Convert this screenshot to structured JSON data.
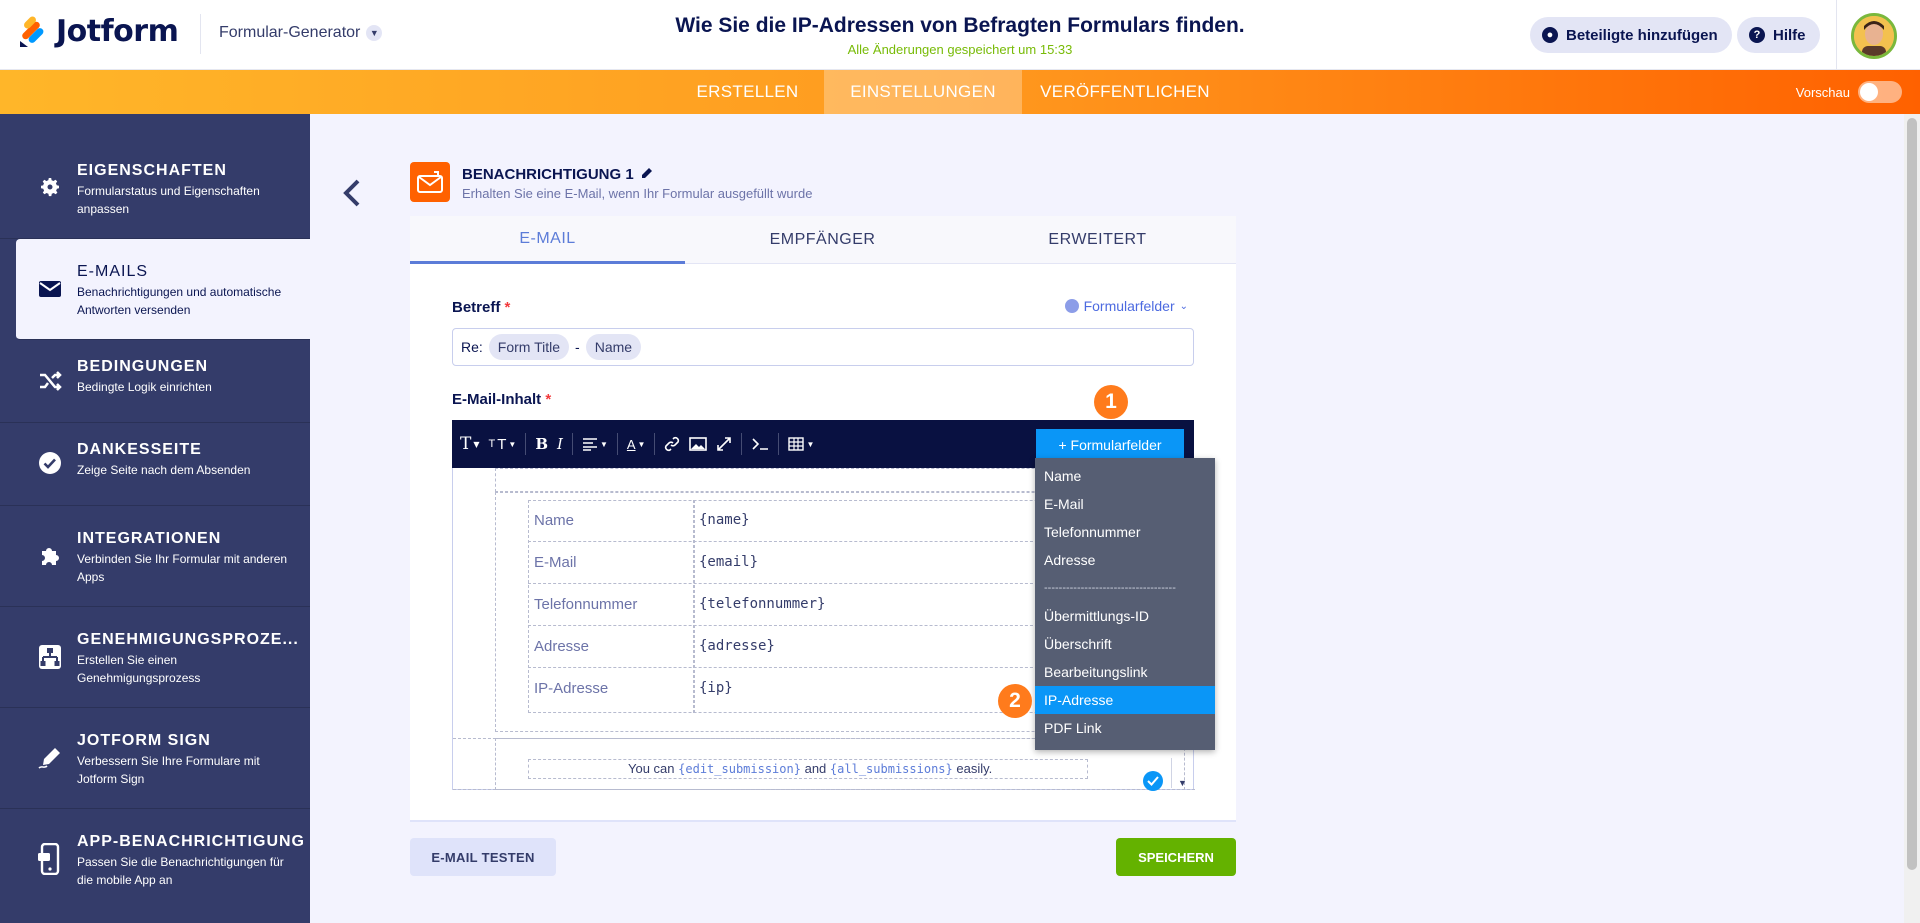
{
  "header": {
    "brand": "Jotform",
    "generator_label": "Formular-Generator",
    "form_title": "Wie Sie die IP-Adressen von Befragten Formulars finden.",
    "saved_status": "Alle Änderungen gespeichert um 15:33",
    "add_participants": "Beteiligte hinzufügen",
    "help": "Hilfe"
  },
  "nav": {
    "tabs": [
      "ERSTELLEN",
      "EINSTELLUNGEN",
      "VERÖFFENTLICHEN"
    ],
    "active": "EINSTELLUNGEN",
    "preview_label": "Vorschau"
  },
  "sidebar": {
    "items": [
      {
        "title": "EIGENSCHAFTEN",
        "desc": "Formularstatus und Eigenschaften anpassen",
        "icon": "gear-icon"
      },
      {
        "title": "E-MAILS",
        "desc": "Benachrichtigungen und automatische Antworten versenden",
        "icon": "envelope-icon"
      },
      {
        "title": "BEDINGUNGEN",
        "desc": "Bedingte Logik einrichten",
        "icon": "shuffle-icon"
      },
      {
        "title": "DANKESSEITE",
        "desc": "Zeige Seite nach dem Absenden",
        "icon": "checkmark-icon"
      },
      {
        "title": "INTEGRATIONEN",
        "desc": "Verbinden Sie Ihr Formular mit anderen Apps",
        "icon": "puzzle-icon"
      },
      {
        "title": "GENEHMIGUNGSPROZE...",
        "desc": "Erstellen Sie einen Genehmigungsprozess",
        "icon": "flowchart-icon"
      },
      {
        "title": "JOTFORM SIGN",
        "desc": "Verbessern Sie Ihre Formulare mit Jotform Sign",
        "icon": "pen-icon"
      },
      {
        "title": "APP-BENACHRICHTIGUNG",
        "desc": "Passen Sie die Benachrichtigungen für die mobile App an",
        "icon": "phone-icon"
      }
    ]
  },
  "notification": {
    "title": "BENACHRICHTIGUNG 1",
    "subtitle": "Erhalten Sie eine E-Mail, wenn Ihr Formular ausgefüllt wurde"
  },
  "tabs": [
    "E-MAIL",
    "EMPFÄNGER",
    "ERWEITERT"
  ],
  "subject": {
    "label": "Betreff",
    "form_fields_link": "Formularfelder",
    "prefix": "Re:",
    "chip1": "Form Title",
    "dash": "-",
    "chip2": "Name"
  },
  "email_body": {
    "label": "E-Mail-Inhalt",
    "form_fields_button": "+ Formularfelder",
    "rows": [
      {
        "key": "Name",
        "value": "{name}"
      },
      {
        "key": "E-Mail",
        "value": "{email}"
      },
      {
        "key": "Telefonnummer",
        "value": "{telefonnummer}"
      },
      {
        "key": "Adresse",
        "value": "{adresse}"
      },
      {
        "key": "IP-Adresse",
        "value": "{ip}"
      }
    ],
    "footer_pre": "You can",
    "footer_tag1": "{edit_submission}",
    "footer_mid": "and",
    "footer_tag2": "{all_submissions}",
    "footer_post": "easily."
  },
  "dropdown": {
    "items": [
      "Name",
      "E-Mail",
      "Telefonnummer",
      "Adresse",
      "------------------------------------",
      "Übermittlungs-ID",
      "Überschrift",
      "Bearbeitungslink",
      "IP-Adresse",
      "PDF Link"
    ],
    "selected": "IP-Adresse"
  },
  "badges": [
    "1",
    "2"
  ],
  "buttons": {
    "test": "E-MAIL TESTEN",
    "save": "SPEICHERN"
  },
  "colors": {
    "brand_orange": "#ff6100",
    "sidebar": "#343c6a",
    "accent_blue": "#0a96f7",
    "save_green": "#64b200"
  }
}
